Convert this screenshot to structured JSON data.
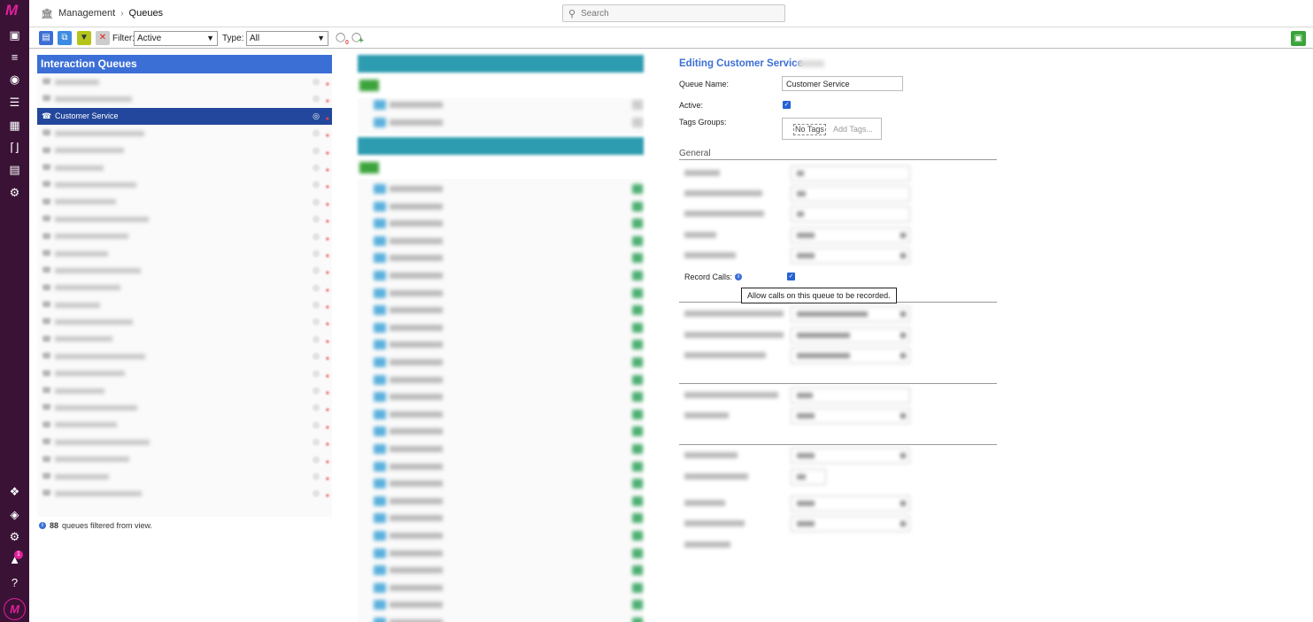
{
  "header": {
    "breadcrumb": [
      "Management",
      "Queues"
    ],
    "search_placeholder": "Search"
  },
  "toolbar": {
    "filter_label": "Filter:",
    "filter_value": "Active",
    "type_label": "Type:",
    "type_value": "All",
    "tag_count": "0"
  },
  "queues": {
    "title": "Interaction Queues",
    "selected": "Customer Service",
    "filtered_count": "88",
    "filtered_text": "queues filtered from view."
  },
  "editor": {
    "title": "Editing Customer Service",
    "queue_name_label": "Queue Name:",
    "queue_name_value": "Customer Service",
    "active_label": "Active:",
    "tags_groups_label": "Tags Groups:",
    "no_tags": "No Tags",
    "add_tags_placeholder": "Add Tags...",
    "section_general": "General",
    "record_calls_label": "Record Calls:",
    "record_calls_tooltip": "Allow calls on this queue to be recorded."
  },
  "notifications": {
    "badge": "1"
  },
  "colors": {
    "accent": "#3c6fd6",
    "selected": "#23479c",
    "rail": "#3a1236",
    "brand": "#e0219a",
    "teal": "#2d9bb0",
    "green": "#3aa33a"
  }
}
